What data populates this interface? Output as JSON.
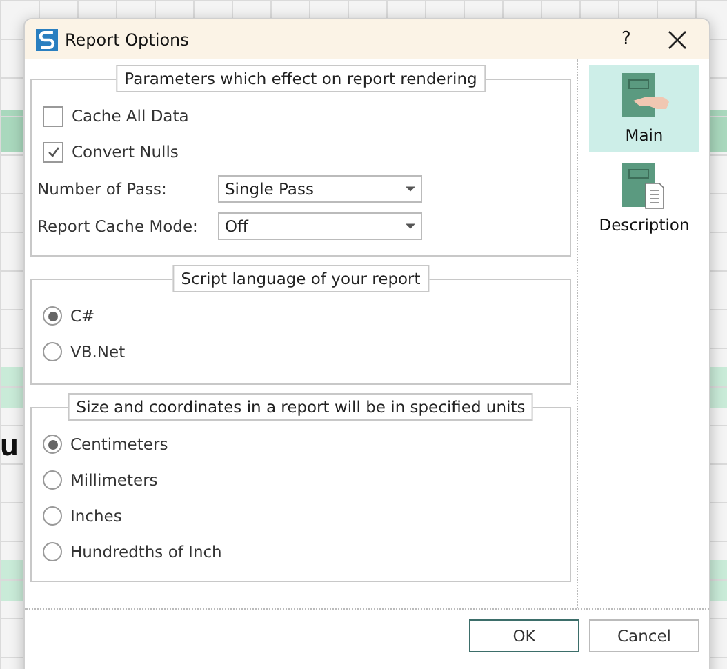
{
  "background_text": "u",
  "window": {
    "title": "Report Options",
    "help": "?"
  },
  "groups": [
    {
      "legend": "Parameters which effect on report rendering",
      "items": [
        {
          "kind": "checkbox",
          "label": "Cache All Data",
          "checked": false
        },
        {
          "kind": "checkbox",
          "label": "Convert Nulls",
          "checked": true
        },
        {
          "kind": "dropdown",
          "label": "Number of Pass:",
          "value": "Single Pass"
        },
        {
          "kind": "dropdown",
          "label": "Report Cache Mode:",
          "value": "Off"
        }
      ]
    },
    {
      "legend": "Script language of your report",
      "items": [
        {
          "kind": "radio",
          "label": "C#",
          "selected": true
        },
        {
          "kind": "radio",
          "label": "VB.Net",
          "selected": false
        }
      ]
    },
    {
      "legend": "Size and coordinates in a report will be in specified units",
      "items": [
        {
          "kind": "radio",
          "label": "Centimeters",
          "selected": true
        },
        {
          "kind": "radio",
          "label": "Millimeters",
          "selected": false
        },
        {
          "kind": "radio",
          "label": "Inches",
          "selected": false
        },
        {
          "kind": "radio",
          "label": "Hundredths of Inch",
          "selected": false
        }
      ]
    }
  ],
  "sidebar": {
    "items": [
      {
        "kind": "hand",
        "label": "Main",
        "selected": true
      },
      {
        "kind": "page",
        "label": "Description",
        "selected": false
      }
    ]
  },
  "buttons": [
    {
      "label": "OK",
      "default": true
    },
    {
      "label": "Cancel",
      "default": false
    }
  ]
}
